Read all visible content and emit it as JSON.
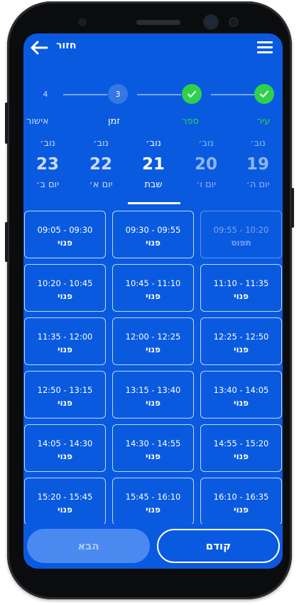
{
  "header": {
    "back_label": "חזור"
  },
  "stepper": {
    "steps": [
      {
        "label": "עיר",
        "status": "done"
      },
      {
        "label": "ספר",
        "status": "done"
      },
      {
        "label": "זמן",
        "status": "current",
        "number": "3"
      },
      {
        "label": "אישור",
        "status": "pending",
        "number": "4"
      }
    ]
  },
  "days": [
    {
      "month": "נוב׳",
      "date": "23",
      "name": "יום ב׳"
    },
    {
      "month": "נוב׳",
      "date": "22",
      "name": "יום א׳"
    },
    {
      "month": "נוב׳",
      "date": "21",
      "name": "שבת",
      "selected": true
    },
    {
      "month": "נוב׳",
      "date": "20",
      "name": "יום ו׳"
    },
    {
      "month": "נוב׳",
      "date": "19",
      "name": "יום ה׳"
    }
  ],
  "slots": [
    {
      "time": "09:05 - 09:30",
      "status": "פנוי"
    },
    {
      "time": "09:30 - 09:55",
      "status": "פנוי"
    },
    {
      "time": "09:55 - 10:20",
      "status": "תפוס"
    },
    {
      "time": "10:20 - 10:45",
      "status": "פנוי"
    },
    {
      "time": "10:45 - 11:10",
      "status": "פנוי"
    },
    {
      "time": "11:10 - 11:35",
      "status": "פנוי"
    },
    {
      "time": "11:35 - 12:00",
      "status": "פנוי"
    },
    {
      "time": "12:00 - 12:25",
      "status": "פנוי"
    },
    {
      "time": "12:25 - 12:50",
      "status": "פנוי"
    },
    {
      "time": "12:50 - 13:15",
      "status": "פנוי"
    },
    {
      "time": "13:15 - 13:40",
      "status": "פנוי"
    },
    {
      "time": "13:40 - 14:05",
      "status": "פנוי"
    },
    {
      "time": "14:05 - 14:30",
      "status": "פנוי"
    },
    {
      "time": "14:30 - 14:55",
      "status": "פנוי"
    },
    {
      "time": "14:55 - 15:20",
      "status": "פנוי"
    },
    {
      "time": "15:20 - 15:45",
      "status": "פנוי"
    },
    {
      "time": "15:45 - 16:10",
      "status": "פנוי"
    },
    {
      "time": "16:10 - 16:35",
      "status": "פנוי"
    }
  ],
  "footer": {
    "next_label": "הבא",
    "prev_label": "קודם"
  },
  "colors": {
    "screen_bg": "#0a5ae0",
    "done_green": "#2fd14a",
    "next_button": "#4a8af0"
  }
}
